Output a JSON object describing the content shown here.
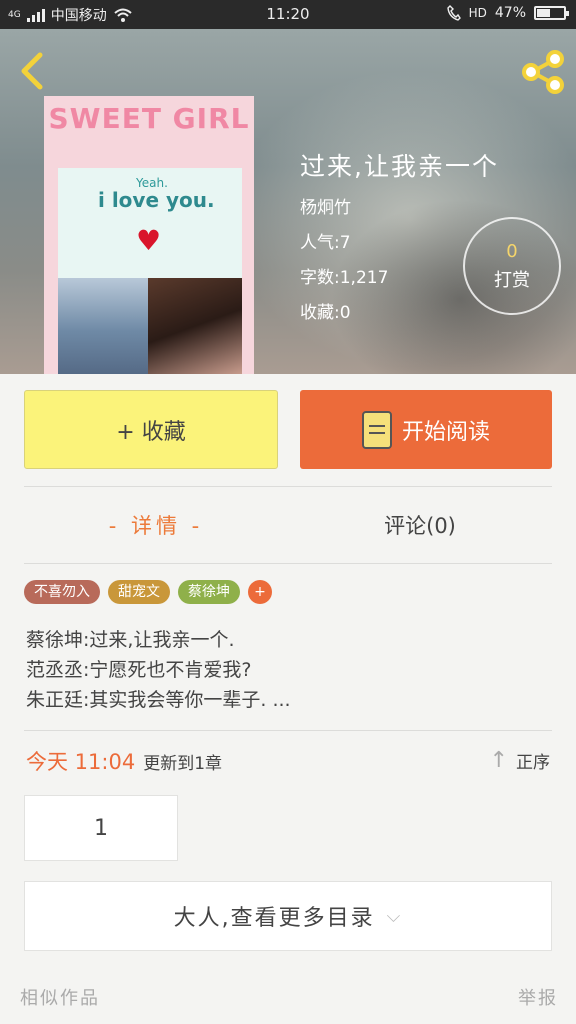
{
  "status_bar": {
    "carrier": "中国移动",
    "network": "4G",
    "time": "11:20",
    "hd": "HD",
    "battery": "47%",
    "battery_level": 0.47
  },
  "book": {
    "title": "过来,让我亲一个",
    "author": "杨炯竹",
    "popularity": "人气:7",
    "word_count": "字数:1,217",
    "favorites": "收藏:0"
  },
  "cover": {
    "title": "SWEET GIRL",
    "subtitle": "Yeah.",
    "text": "i love you.",
    "heart": "♥"
  },
  "tip": {
    "count": "0",
    "label": "打赏"
  },
  "actions": {
    "favorite_label": "+ 收藏",
    "read_label": "开始阅读"
  },
  "tabs": [
    {
      "label": "- 详情 -"
    },
    {
      "label": "评论(0)"
    }
  ],
  "tags": [
    {
      "label": "不喜勿入",
      "color": "#b86a5a"
    },
    {
      "label": "甜宠文",
      "color": "#c9973a"
    },
    {
      "label": "蔡徐坤",
      "color": "#8fb04a"
    },
    {
      "label": "+",
      "color": "#ec6b3a"
    }
  ],
  "synopsis": [
    "蔡徐坤:过来,让我亲一个.",
    "范丞丞:宁愿死也不肯爱我?",
    "朱正廷:其实我会等你一辈子. ..."
  ],
  "update": {
    "time": "今天 11:04",
    "text": "更新到1章",
    "order_label": "正序"
  },
  "chapters": [
    {
      "label": "1"
    }
  ],
  "more_label": "大人,查看更多目录",
  "footer": {
    "similar": "相似作品",
    "report": "举报"
  },
  "colors": {
    "accent": "#ec6b3a",
    "favorite_bg": "#fbf37a",
    "tip_number": "#f5d56b"
  }
}
